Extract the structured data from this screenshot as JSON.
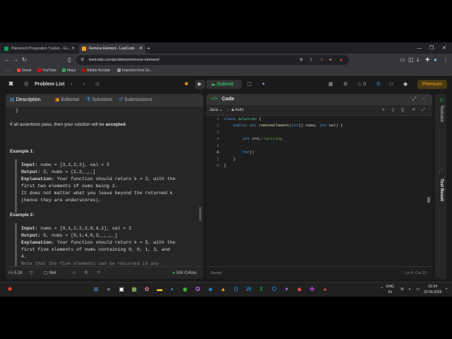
{
  "browser": {
    "tabs": [
      {
        "title": "Placement Preparation Tracker - Go…",
        "fav_color": "#0f9d58"
      },
      {
        "title": "Remove Element - LeetCode",
        "fav_color": "#ffa116"
      }
    ],
    "new_tab": "+",
    "url": "leetcode.com/problems/remove-element/",
    "bookmarks": [
      "Gmail",
      "YouTube",
      "Maps",
      "Adobe Acrobat",
      "Imported from Go…"
    ],
    "bookmark_colors": [
      "#ea4335",
      "#ff0000",
      "#34a853",
      "#b30b00",
      "#999999"
    ]
  },
  "nav": {
    "problem_list": "Problem List",
    "submit": "Submit",
    "streak": "0",
    "premium": "Premium"
  },
  "left": {
    "tabs": [
      "Description",
      "Editorial",
      "Solutions",
      "Submissions"
    ],
    "brace": "}",
    "pass_text": "If all assertions pass, then your solution will be ",
    "accepted": "accepted",
    "period": ".",
    "example1": "Example 1:",
    "ex1_input_label": "Input:",
    "ex1_input": " nums = [3,2,2,3], val = 3",
    "ex1_output_label": "Output:",
    "ex1_output": " 2, nums = [2,2,_,_]",
    "ex1_expl_label": "Explanation:",
    "ex1_expl1": " Your function should return k = 2, with the",
    "ex1_expl2": "first two elements of nums being 2.",
    "ex1_expl3": "It does not matter what you leave beyond the returned k",
    "ex1_expl4": "(hence they are underscores).",
    "example2": "Example 2:",
    "ex2_input_label": "Input:",
    "ex2_input": " nums = [0,1,2,2,3,0,4,2], val = 2",
    "ex2_output_label": "Output:",
    "ex2_output": " 5, nums = [0,1,4,0,3,_,_,_]",
    "ex2_expl_label": "Explanation:",
    "ex2_expl1": " Your function should return k = 5, with the",
    "ex2_expl2": "first five elements of nums containing 0, 0, 1, 3, and",
    "ex2_expl3": "4.",
    "ex2_expl4": "Note that the five elements can be returned in any",
    "likes": "5.2K",
    "comments": "964",
    "online": "306 Online"
  },
  "right": {
    "title": "Code",
    "language": "Java",
    "mode": "Auto",
    "lines": [
      "1",
      "2",
      "3",
      "4",
      "5",
      "6",
      "7",
      "8"
    ],
    "saved": "Saved",
    "cursor": "Ln 6, Col 13",
    "testcase": "Testcase",
    "test_result": "Test Result"
  },
  "taskbar": {
    "lang1": "ENG",
    "lang2": "IN",
    "time": "22:24",
    "date": "22-06-2025"
  }
}
